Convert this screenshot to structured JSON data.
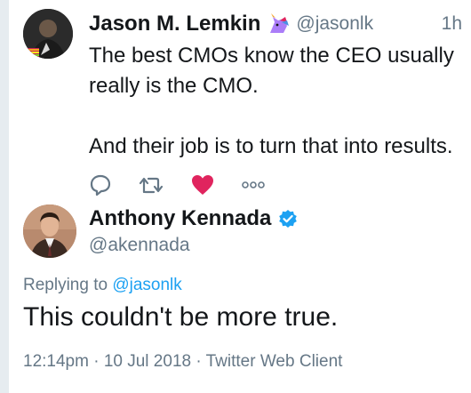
{
  "parent_tweet": {
    "author_name": "Jason M. Lemkin",
    "author_handle": "@jasonlk",
    "time": "1h",
    "text_line_1": "The best CMOs know the CEO usually really is the CMO.",
    "text_line_2": "And their job is to turn that into results.",
    "actions": {
      "reply_icon": "reply-icon",
      "retweet_icon": "retweet-icon",
      "like_icon": "heart-icon",
      "more_icon": "more-icon"
    },
    "liked": true
  },
  "reply_tweet": {
    "author_name": "Anthony Kennada",
    "author_handle": "@akennada",
    "verified": true,
    "replying_prefix": "Replying to",
    "replying_mention": "@jasonlk",
    "text": "This couldn't be more true.",
    "meta": "12:14pm · 10 Jul 2018 · Twitter Web Client"
  },
  "colors": {
    "accent_blue": "#1da1f2",
    "like_red": "#e0245e",
    "muted_text": "#657786",
    "primary_text": "#14171a",
    "rail": "#e6ecf0"
  }
}
